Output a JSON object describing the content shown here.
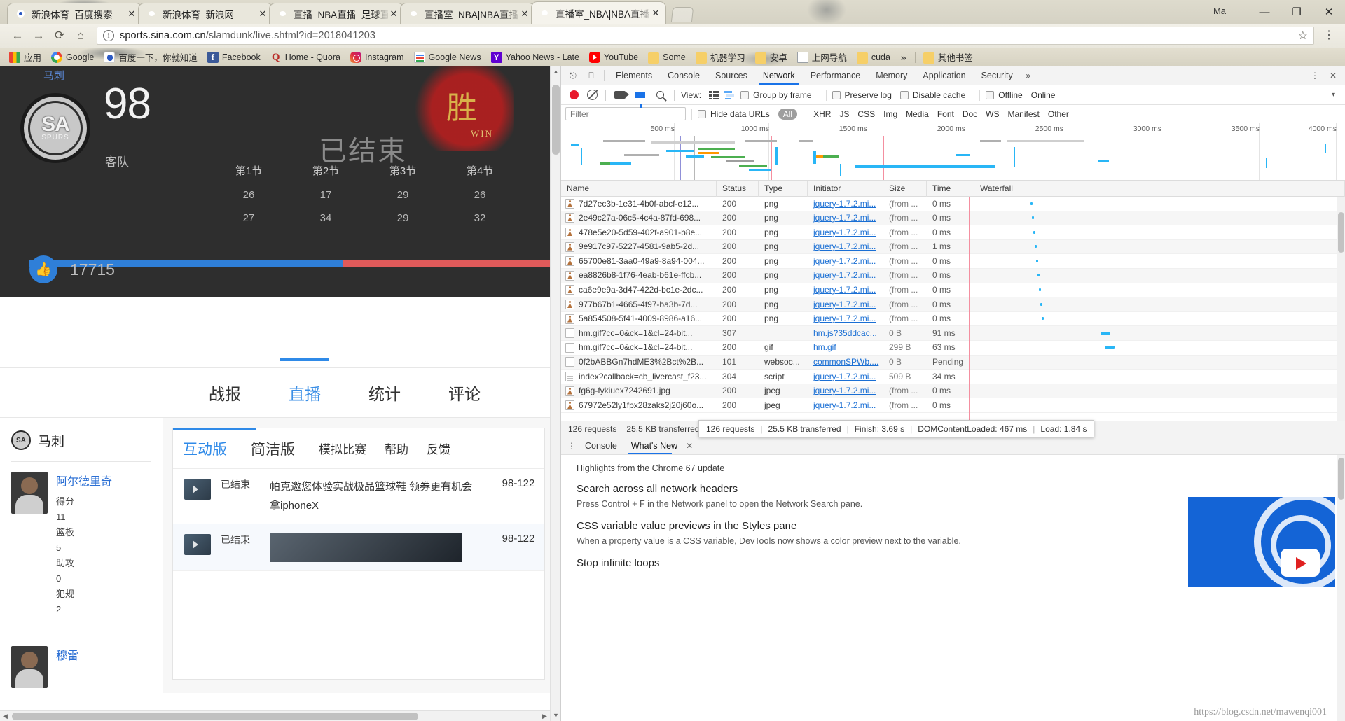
{
  "browser": {
    "tabs": [
      {
        "title": "新浪体育_百度搜索",
        "favicon": "baidu-favicon",
        "active": false
      },
      {
        "title": "新浪体育_新浪网",
        "favicon": "sina-favicon",
        "active": false
      },
      {
        "title": "直播_NBA直播_足球直播",
        "favicon": "sina-favicon",
        "active": false
      },
      {
        "title": "直播室_NBA|NBA直播|N",
        "favicon": "sina-favicon",
        "active": false
      },
      {
        "title": "直播室_NBA|NBA直播|N",
        "favicon": "sina-favicon",
        "active": true
      }
    ],
    "tab_close_label": "✕",
    "window_controls": {
      "partial_text": "Ma",
      "minimize": "—",
      "maximize": "❐",
      "close": "✕"
    },
    "omnibox": {
      "back": "←",
      "forward": "→",
      "reload": "⟳",
      "home": "⌂",
      "secure_icon": "ⓘ",
      "url_host": "sports.sina.com.cn",
      "url_path": "/slamdunk/live.shtml?id=2018041203",
      "star": "☆",
      "menu": "⋮"
    },
    "bookmarks": [
      {
        "label": "应用",
        "icon": "apps-grid-icon"
      },
      {
        "label": "Google",
        "icon": "google-icon"
      },
      {
        "label": "百度一下，你就知道",
        "icon": "baidu-icon"
      },
      {
        "label": "Facebook",
        "icon": "facebook-icon"
      },
      {
        "label": "Home - Quora",
        "icon": "quora-icon"
      },
      {
        "label": "Instagram",
        "icon": "instagram-icon"
      },
      {
        "label": "Google News",
        "icon": "google-news-icon"
      },
      {
        "label": "Yahoo News - Late",
        "icon": "yahoo-icon"
      },
      {
        "label": "YouTube",
        "icon": "youtube-icon"
      },
      {
        "label": "Some",
        "icon": "folder-icon"
      },
      {
        "label": "机器学习",
        "icon": "folder-icon"
      },
      {
        "label": "安卓",
        "icon": "folder-icon"
      },
      {
        "label": "上网导航",
        "icon": "doc-icon"
      },
      {
        "label": "cuda",
        "icon": "folder-icon"
      }
    ],
    "bookmarks_overflow": "»",
    "bookmarks_other": {
      "label": "其他书签",
      "icon": "folder-icon"
    }
  },
  "page": {
    "scoreboard": {
      "team_link": "马刺",
      "logo_primary": "SA",
      "logo_secondary": "SPURS",
      "score": "98",
      "side_label": "客队",
      "status": "已结束",
      "win_badge": "胜",
      "win_badge_sub": "WIN",
      "quarter_headers": [
        "第1节",
        "第2节",
        "第3节",
        "第4节"
      ],
      "quarter_rows": [
        [
          "26",
          "17",
          "29",
          "26"
        ],
        [
          "27",
          "34",
          "29",
          "32"
        ]
      ],
      "like_icon": "thumbs-up-icon",
      "like_count": "17715",
      "like_bar_percent": 59
    },
    "main_tabs": [
      {
        "label": "战报",
        "active": false
      },
      {
        "label": "直播",
        "active": true
      },
      {
        "label": "统计",
        "active": false
      },
      {
        "label": "评论",
        "active": false
      }
    ],
    "left_column": {
      "team_logo": "SA",
      "team_name": "马刺",
      "players": [
        {
          "name": "阿尔德里奇",
          "stats": [
            {
              "label": "得分",
              "value": "11"
            },
            {
              "label": "篮板",
              "value": "5"
            },
            {
              "label": "助攻",
              "value": "0"
            },
            {
              "label": "犯规",
              "value": "2"
            }
          ]
        },
        {
          "name": "穆雷",
          "stats": []
        }
      ]
    },
    "live_panel": {
      "tabs": [
        {
          "label": "互动版",
          "active": true,
          "size": "large"
        },
        {
          "label": "简洁版",
          "active": false,
          "size": "large"
        },
        {
          "label": "模拟比赛",
          "active": false,
          "size": "small"
        },
        {
          "label": "帮助",
          "active": false,
          "size": "small"
        },
        {
          "label": "反馈",
          "active": false,
          "size": "small"
        }
      ],
      "rows": [
        {
          "status": "已结束",
          "text": "帕克邀您体验实战极品篮球鞋 领券更有机会拿iphoneX",
          "score": "98-122",
          "has_image": false
        },
        {
          "status": "已结束",
          "text": "",
          "score": "98-122",
          "has_image": true
        }
      ]
    }
  },
  "devtools": {
    "inspect_icon": "cursor-select-icon",
    "device_icon": "device-toggle-icon",
    "panel_tabs": [
      {
        "label": "Elements",
        "active": false
      },
      {
        "label": "Console",
        "active": false
      },
      {
        "label": "Sources",
        "active": false
      },
      {
        "label": "Network",
        "active": true
      },
      {
        "label": "Performance",
        "active": false
      },
      {
        "label": "Memory",
        "active": false
      },
      {
        "label": "Application",
        "active": false
      },
      {
        "label": "Security",
        "active": false
      }
    ],
    "panel_overflow": "»",
    "settings_icon": "kebab-menu-icon",
    "close_icon": "close-icon",
    "toolbar": {
      "record_icon": "record-icon",
      "clear_icon": "clear-icon",
      "camera_icon": "screenshot-icon",
      "filter_icon": "filter-icon",
      "search_icon": "search-icon",
      "view_label": "View:",
      "view_list_icon": "list-view-icon",
      "view_waterfall_icon": "waterfall-view-icon",
      "group_by_frame": "Group by frame",
      "preserve_log": "Preserve log",
      "disable_cache": "Disable cache",
      "offline": "Offline",
      "online": "Online",
      "caret": "▾"
    },
    "filterbar": {
      "placeholder": "Filter",
      "hide_data_urls": "Hide data URLs",
      "types": [
        "All",
        "XHR",
        "JS",
        "CSS",
        "Img",
        "Media",
        "Font",
        "Doc",
        "WS",
        "Manifest",
        "Other"
      ],
      "active_type": "All"
    },
    "overview_ticks": [
      "500 ms",
      "1000 ms",
      "1500 ms",
      "2000 ms",
      "2500 ms",
      "3000 ms",
      "3500 ms",
      "4000 ms"
    ],
    "columns": [
      "Name",
      "Status",
      "Type",
      "Initiator",
      "Size",
      "Time",
      "Waterfall"
    ],
    "requests": [
      {
        "name": "7d27ec3b-1e31-4b0f-abcf-e12...",
        "status": "200",
        "type": "png",
        "initiator": "jquery-1.7.2.mi...",
        "size": "(from ...",
        "time": "0 ms",
        "icon": "image-icon"
      },
      {
        "name": "2e49c27a-06c5-4c4a-87fd-698...",
        "status": "200",
        "type": "png",
        "initiator": "jquery-1.7.2.mi...",
        "size": "(from ...",
        "time": "0 ms",
        "icon": "image-icon"
      },
      {
        "name": "478e5e20-5d59-402f-a901-b8e...",
        "status": "200",
        "type": "png",
        "initiator": "jquery-1.7.2.mi...",
        "size": "(from ...",
        "time": "0 ms",
        "icon": "image-icon"
      },
      {
        "name": "9e917c97-5227-4581-9ab5-2d...",
        "status": "200",
        "type": "png",
        "initiator": "jquery-1.7.2.mi...",
        "size": "(from ...",
        "time": "1 ms",
        "icon": "image-icon"
      },
      {
        "name": "65700e81-3aa0-49a9-8a94-004...",
        "status": "200",
        "type": "png",
        "initiator": "jquery-1.7.2.mi...",
        "size": "(from ...",
        "time": "0 ms",
        "icon": "image-icon"
      },
      {
        "name": "ea8826b8-1f76-4eab-b61e-ffcb...",
        "status": "200",
        "type": "png",
        "initiator": "jquery-1.7.2.mi...",
        "size": "(from ...",
        "time": "0 ms",
        "icon": "image-icon"
      },
      {
        "name": "ca6e9e9a-3d47-422d-bc1e-2dc...",
        "status": "200",
        "type": "png",
        "initiator": "jquery-1.7.2.mi...",
        "size": "(from ...",
        "time": "0 ms",
        "icon": "image-icon"
      },
      {
        "name": "977b67b1-4665-4f97-ba3b-7d...",
        "status": "200",
        "type": "png",
        "initiator": "jquery-1.7.2.mi...",
        "size": "(from ...",
        "time": "0 ms",
        "icon": "image-icon"
      },
      {
        "name": "5a854508-5f41-4009-8986-a16...",
        "status": "200",
        "type": "png",
        "initiator": "jquery-1.7.2.mi...",
        "size": "(from ...",
        "time": "0 ms",
        "icon": "image-icon"
      },
      {
        "name": "hm.gif?cc=0&ck=1&cl=24-bit...",
        "status": "307",
        "type": "",
        "initiator": "hm.js?35ddcac...",
        "size": "0 B",
        "time": "91 ms",
        "icon": "doc-icon"
      },
      {
        "name": "hm.gif?cc=0&ck=1&cl=24-bit...",
        "status": "200",
        "type": "gif",
        "initiator": "hm.gif",
        "size": "299 B",
        "time": "63 ms",
        "icon": "doc-icon"
      },
      {
        "name": "0f2bABBGn7hdME3%2Bct%2B...",
        "status": "101",
        "type": "websoc...",
        "initiator": "commonSPWb....",
        "size": "0 B",
        "time": "Pending",
        "icon": "doc-icon"
      },
      {
        "name": "index?callback=cb_livercast_f23...",
        "status": "304",
        "type": "script",
        "initiator": "jquery-1.7.2.mi...",
        "size": "509 B",
        "time": "34 ms",
        "icon": "script-icon"
      },
      {
        "name": "fg6g-fykiuex7242691.jpg",
        "status": "200",
        "type": "jpeg",
        "initiator": "jquery-1.7.2.mi...",
        "size": "(from ...",
        "time": "0 ms",
        "icon": "image-icon"
      },
      {
        "name": "67972e52ly1fpx28zaks2j20j60o...",
        "status": "200",
        "type": "jpeg",
        "initiator": "jquery-1.7.2.mi...",
        "size": "(from ...",
        "time": "0 ms",
        "icon": "image-icon"
      }
    ],
    "status_bar": {
      "requests": "126 requests",
      "transferred": "25.5 KB transferred",
      "finish_partial": "Finish: 3.69 s"
    },
    "status_tooltip": {
      "requests": "126 requests",
      "transferred": "25.5 KB transferred",
      "finish": "Finish: 3.69 s",
      "dom": "DOMContentLoaded: 467 ms",
      "load": "Load: 1.84 s"
    },
    "drawer": {
      "kebab": "⋮",
      "tabs": [
        {
          "label": "Console",
          "active": false
        },
        {
          "label": "What's New",
          "active": true
        }
      ],
      "close": "✕",
      "heading": "Highlights from the Chrome 67 update",
      "items": [
        {
          "title": "Search across all network headers",
          "desc": "Press Control + F in the Network panel to open the Network Search pane."
        },
        {
          "title": "CSS variable value previews in the Styles pane",
          "desc": "When a property value is a CSS variable, DevTools now shows a color preview next to the variable."
        },
        {
          "title": "Stop infinite loops",
          "desc": ""
        }
      ],
      "promo_icon": "youtube-play-icon",
      "watermark": "https://blog.csdn.net/mawenqi001"
    }
  }
}
